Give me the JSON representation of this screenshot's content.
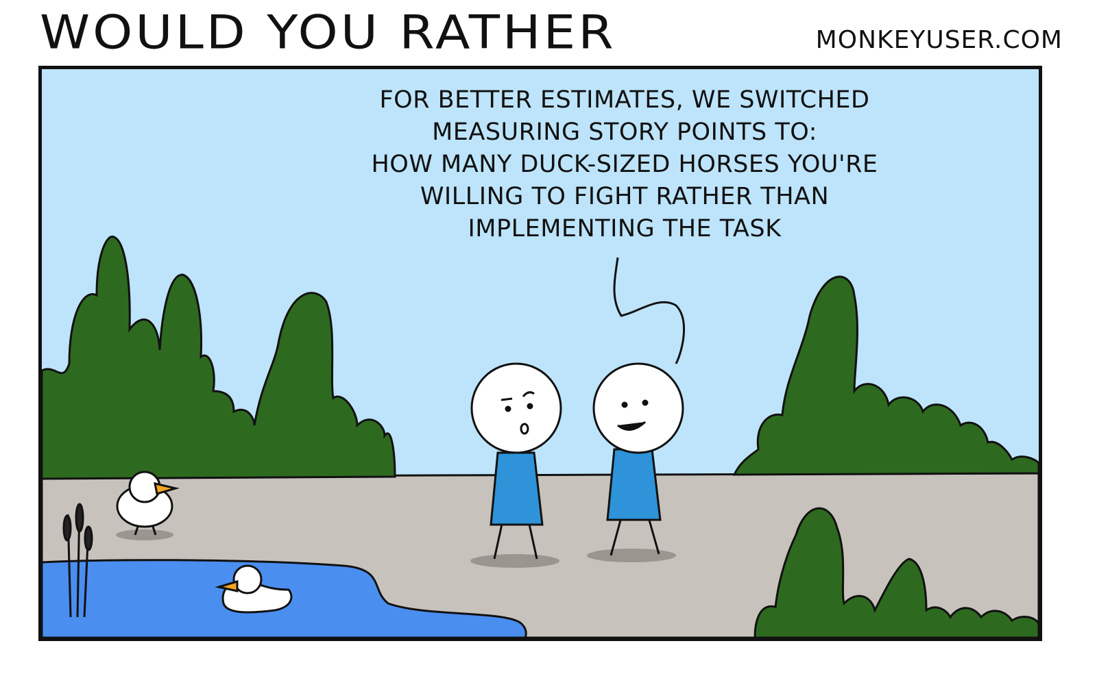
{
  "header": {
    "title": "WOULD YOU RATHER",
    "site": "MONKEYUSER.COM"
  },
  "panel": {
    "speech_lines": [
      "FOR BETTER ESTIMATES, WE SWITCHED",
      "MEASURING STORY POINTS TO:",
      "HOW MANY DUCK-SIZED HORSES YOU'RE",
      "WILLING TO FIGHT RATHER THAN",
      "IMPLEMENTING THE TASK"
    ]
  },
  "colors": {
    "sky": "#bde4fb",
    "ground": "#c7c2bc",
    "bush": "#2d6a1f",
    "pond": "#4a8ef0",
    "shirt": "#2e93d8"
  }
}
